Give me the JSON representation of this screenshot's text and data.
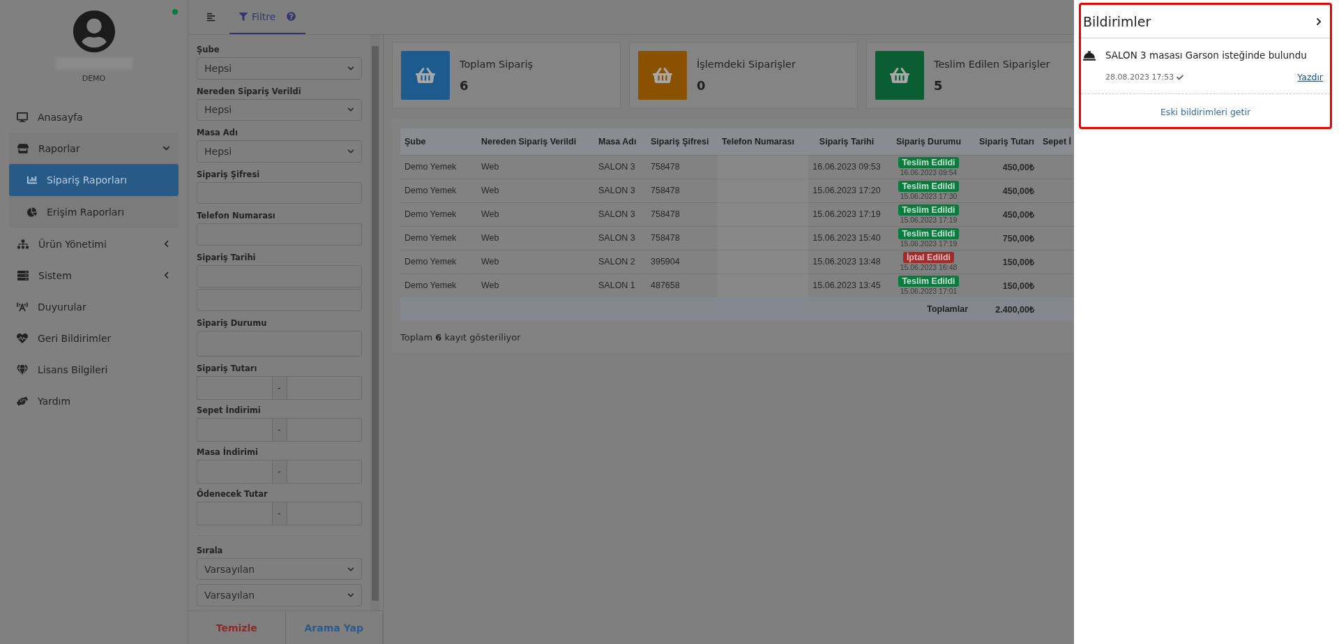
{
  "sidebar": {
    "user_label": "DEMO",
    "online": true,
    "items": [
      {
        "label": "Anasayfa",
        "kind": "link",
        "selected": false
      },
      {
        "label": "Raporlar",
        "kind": "group",
        "selected": false,
        "expanded": true,
        "children": [
          {
            "label": "Sipariş Raporları",
            "selected": true
          },
          {
            "label": "Erişim Raporları",
            "selected": false
          }
        ]
      },
      {
        "label": "Ürün Yönetimi",
        "kind": "group",
        "selected": false,
        "expanded": false
      },
      {
        "label": "Sistem",
        "kind": "group",
        "selected": false,
        "expanded": false
      },
      {
        "label": "Duyurular",
        "kind": "link",
        "selected": false
      },
      {
        "label": "Geri Bildirimler",
        "kind": "link",
        "selected": false
      },
      {
        "label": "Lisans Bilgileri",
        "kind": "link",
        "selected": false
      },
      {
        "label": "Yardım",
        "kind": "link",
        "selected": false
      }
    ]
  },
  "tabs": [
    {
      "label": "Filtre",
      "selected": true
    }
  ],
  "filter": {
    "fields": [
      {
        "label": "Şube",
        "kind": "select",
        "value": "Hepsi"
      },
      {
        "label": "Nereden Sipariş Verildi",
        "kind": "select",
        "value": "Hepsi"
      },
      {
        "label": "Masa Adı",
        "kind": "select",
        "value": "Hepsi"
      },
      {
        "label": "Sipariş Şifresi",
        "kind": "text"
      },
      {
        "label": "Telefon Numarası",
        "kind": "text"
      },
      {
        "label": "Sipariş Tarihi",
        "kind": "double"
      },
      {
        "label": "Sipariş Durumu",
        "kind": "tall"
      },
      {
        "label": "Sipariş Tutarı",
        "kind": "range",
        "separator": "-"
      },
      {
        "label": "Sepet İndirimi",
        "kind": "range",
        "separator": "-"
      },
      {
        "label": "Masa İndirimi",
        "kind": "range",
        "separator": "-"
      },
      {
        "label": "Ödenecek Tutar",
        "kind": "range",
        "separator": "-"
      }
    ],
    "sort": {
      "label": "Sırala",
      "selects": [
        "Varsayılan",
        "Varsayılan"
      ]
    },
    "clear_button": "Temizle",
    "search_button": "Arama Yap"
  },
  "stats": [
    {
      "title": "Toplam Sipariş",
      "value": "6",
      "color": "#1d5a8e"
    },
    {
      "title": "İşlemdeki Siparişler",
      "value": "0",
      "color": "#8a5200"
    },
    {
      "title": "Teslim Edilen Siparişler",
      "value": "5",
      "color": "#0b5e33"
    }
  ],
  "table": {
    "columns": [
      "Şube",
      "Nereden Sipariş Verildi",
      "Masa Adı",
      "Sipariş Şifresi",
      "Telefon Numarası",
      "Sipariş Tarihi",
      "Sipariş Durumu",
      "Sipariş Tutarı",
      "Sepet İ"
    ],
    "rows": [
      {
        "branch": "Demo Yemek",
        "source": "Web",
        "table": "SALON 3",
        "code": "758478",
        "date": "16.06.2023 09:53",
        "status": {
          "label": "Teslim Edildi",
          "kind": "delivered",
          "time": "16.06.2023 09:54"
        },
        "amount": "450,00₺"
      },
      {
        "branch": "Demo Yemek",
        "source": "Web",
        "table": "SALON 3",
        "code": "758478",
        "date": "15.06.2023 17:20",
        "status": {
          "label": "Teslim Edildi",
          "kind": "delivered",
          "time": "15.06.2023 17:30"
        },
        "amount": "450,00₺"
      },
      {
        "branch": "Demo Yemek",
        "source": "Web",
        "table": "SALON 3",
        "code": "758478",
        "date": "15.06.2023 17:19",
        "status": {
          "label": "Teslim Edildi",
          "kind": "delivered",
          "time": "15.06.2023 17:19"
        },
        "amount": "450,00₺"
      },
      {
        "branch": "Demo Yemek",
        "source": "Web",
        "table": "SALON 3",
        "code": "758478",
        "date": "15.06.2023 15:40",
        "status": {
          "label": "Teslim Edildi",
          "kind": "delivered",
          "time": "15.06.2023 17:19"
        },
        "amount": "750,00₺"
      },
      {
        "branch": "Demo Yemek",
        "source": "Web",
        "table": "SALON 2",
        "code": "395904",
        "date": "15.06.2023 13:48",
        "status": {
          "label": "İptal Edildi",
          "kind": "cancelled",
          "time": "15.06.2023 16:48"
        },
        "amount": "150,00₺"
      },
      {
        "branch": "Demo Yemek",
        "source": "Web",
        "table": "SALON 1",
        "code": "487658",
        "date": "15.06.2023 13:45",
        "status": {
          "label": "Teslim Edildi",
          "kind": "delivered",
          "time": "15.06.2023 17:01"
        },
        "amount": "150,00₺"
      }
    ],
    "totals_label": "Toplamlar",
    "totals_value": "2.400,00₺",
    "footer": "Toplam **6** kayıt gösteriliyor"
  },
  "notifications": {
    "title": "Bildirimler",
    "items": [
      {
        "text": "SALON 3 masası Garson isteğinde bulundu",
        "time": "28.08.2023 17:53",
        "read": true,
        "action": "Yazdır"
      }
    ],
    "more": "Eski bildirimleri getir"
  }
}
